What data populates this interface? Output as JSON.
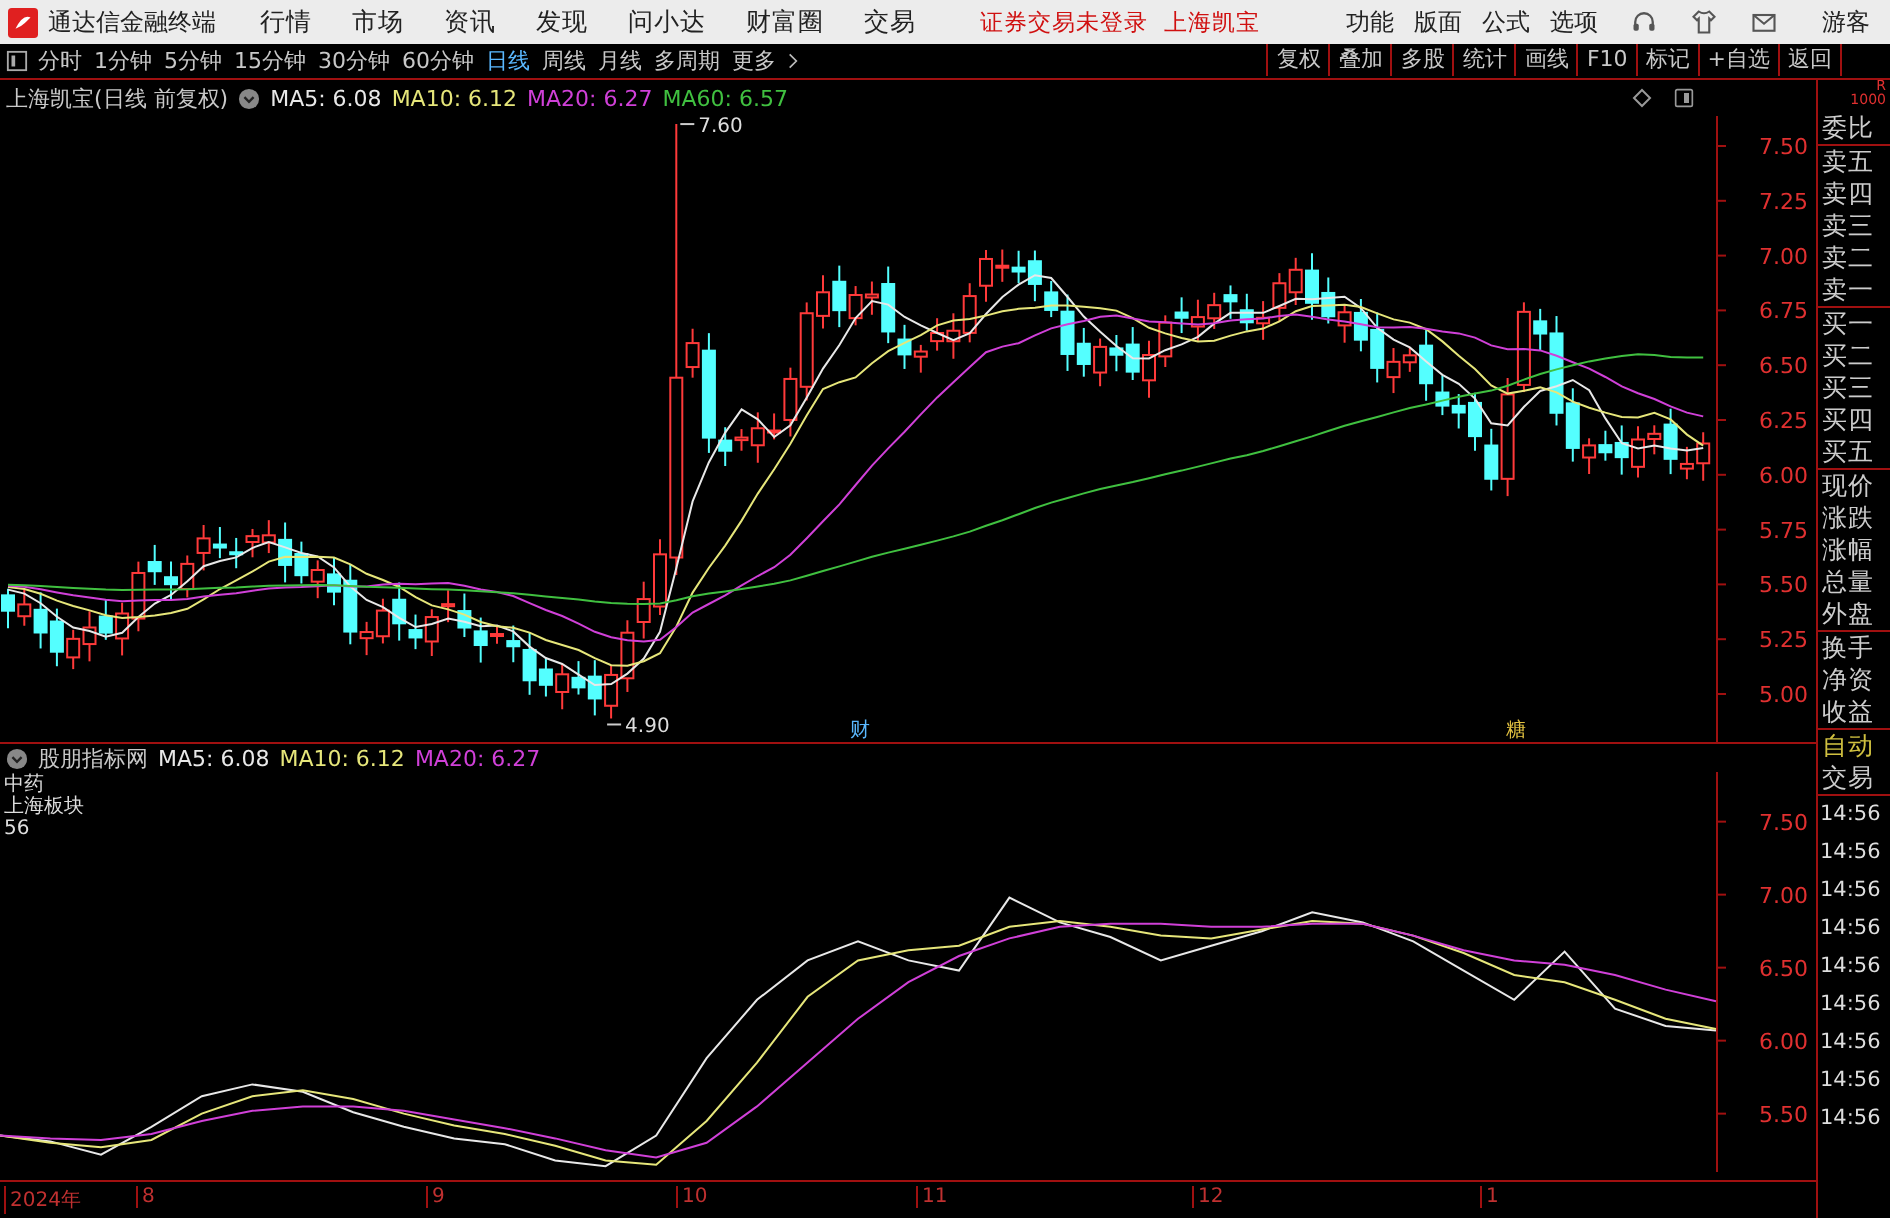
{
  "app": {
    "title": "通达信金融终端"
  },
  "menu": [
    "行情",
    "市场",
    "资讯",
    "发现",
    "问小达",
    "财富圈",
    "交易"
  ],
  "notice": "证券交易未登录",
  "stock_name": "上海凯宝",
  "menu_right": [
    "功能",
    "版面",
    "公式",
    "选项"
  ],
  "user": "游客",
  "periods": [
    {
      "label": "分时",
      "selected": false
    },
    {
      "label": "1分钟",
      "selected": false
    },
    {
      "label": "5分钟",
      "selected": false
    },
    {
      "label": "15分钟",
      "selected": false
    },
    {
      "label": "30分钟",
      "selected": false
    },
    {
      "label": "60分钟",
      "selected": false
    },
    {
      "label": "日线",
      "selected": true
    },
    {
      "label": "周线",
      "selected": false
    },
    {
      "label": "月线",
      "selected": false
    },
    {
      "label": "多周期",
      "selected": false
    }
  ],
  "more": "更多",
  "tools": [
    "复权",
    "叠加",
    "多股",
    "统计",
    "画线",
    "F10",
    "标记",
    "+自选",
    "返回"
  ],
  "main_chart": {
    "title": "上海凯宝(日线 前复权)",
    "indicators": [
      {
        "label": "MA5: 6.08",
        "color": "#e8e8e8"
      },
      {
        "label": "MA10: 6.12",
        "color": "#e6e67a"
      },
      {
        "label": "MA20: 6.27",
        "color": "#d040d8"
      },
      {
        "label": "MA60: 6.57",
        "color": "#40c040"
      }
    ],
    "high_label": "7.60",
    "low_label": "4.90",
    "event_markers": [
      "财",
      "糖"
    ],
    "y_ticks": [
      "7.50",
      "7.25",
      "7.00",
      "6.75",
      "6.50",
      "6.25",
      "6.00",
      "5.75",
      "5.50",
      "5.25",
      "5.00"
    ]
  },
  "sub_chart": {
    "title": "股朋指标网",
    "indicators": [
      {
        "label": "MA5: 6.08",
        "color": "#e8e8e8"
      },
      {
        "label": "MA10: 6.12",
        "color": "#e6e67a"
      },
      {
        "label": "MA20: 6.27",
        "color": "#d040d8"
      }
    ],
    "notes": [
      "中药",
      "上海板块",
      "56"
    ],
    "chart_data": {
      "type": "line",
      "ylim": [
        5.1,
        7.84
      ],
      "yticks": [
        {
          "value": 7.5,
          "label": "7.50"
        },
        {
          "value": 7,
          "label": "7.00"
        },
        {
          "value": 6.5,
          "label": "6.50"
        },
        {
          "value": 6,
          "label": "6.00"
        },
        {
          "value": 5.5,
          "label": "5.50"
        }
      ],
      "series": [
        {
          "color": "#e8e8e8",
          "values": [
            5.35,
            5.31,
            5.22,
            5.41,
            5.62,
            5.7,
            5.65,
            5.51,
            5.41,
            5.33,
            5.29,
            5.18,
            5.14,
            5.35,
            5.88,
            6.28,
            6.55,
            6.68,
            6.55,
            6.48,
            6.98,
            6.81,
            6.71,
            6.55,
            6.65,
            6.75,
            6.88,
            6.81,
            6.68,
            6.48,
            6.28,
            6.61,
            6.22,
            6.1,
            6.07
          ]
        },
        {
          "color": "#e6e67a",
          "values": [
            5.35,
            5.3,
            5.27,
            5.32,
            5.5,
            5.62,
            5.66,
            5.6,
            5.5,
            5.42,
            5.36,
            5.28,
            5.18,
            5.15,
            5.45,
            5.85,
            6.3,
            6.55,
            6.62,
            6.65,
            6.78,
            6.82,
            6.78,
            6.72,
            6.7,
            6.76,
            6.82,
            6.8,
            6.72,
            6.6,
            6.45,
            6.4,
            6.28,
            6.15,
            6.08
          ]
        },
        {
          "color": "#d040d8",
          "values": [
            5.35,
            5.33,
            5.32,
            5.36,
            5.45,
            5.52,
            5.55,
            5.55,
            5.52,
            5.46,
            5.4,
            5.33,
            5.25,
            5.2,
            5.3,
            5.55,
            5.85,
            6.15,
            6.4,
            6.58,
            6.7,
            6.78,
            6.8,
            6.8,
            6.78,
            6.78,
            6.8,
            6.8,
            6.72,
            6.62,
            6.55,
            6.52,
            6.45,
            6.35,
            6.27
          ]
        }
      ]
    }
  },
  "x_axis": [
    "2024年",
    "8",
    "9",
    "10",
    "11",
    "12",
    "1"
  ],
  "side_panel": {
    "badge": [
      "R",
      "1000"
    ],
    "quote_groups": [
      [
        "委比"
      ],
      [
        "卖五",
        "卖四",
        "卖三",
        "卖二",
        "卖一"
      ],
      [
        "买一",
        "买二",
        "买三",
        "买四",
        "买五"
      ],
      [
        "现价",
        "涨跌",
        "涨幅",
        "总量",
        "外盘"
      ],
      [
        "换手",
        "净资",
        "收益"
      ]
    ],
    "auto": "自动",
    "trade": "交易",
    "times": [
      "14:56",
      "14:56",
      "14:56",
      "14:56",
      "14:56",
      "14:56",
      "14:56",
      "14:56",
      "14:56"
    ]
  }
}
